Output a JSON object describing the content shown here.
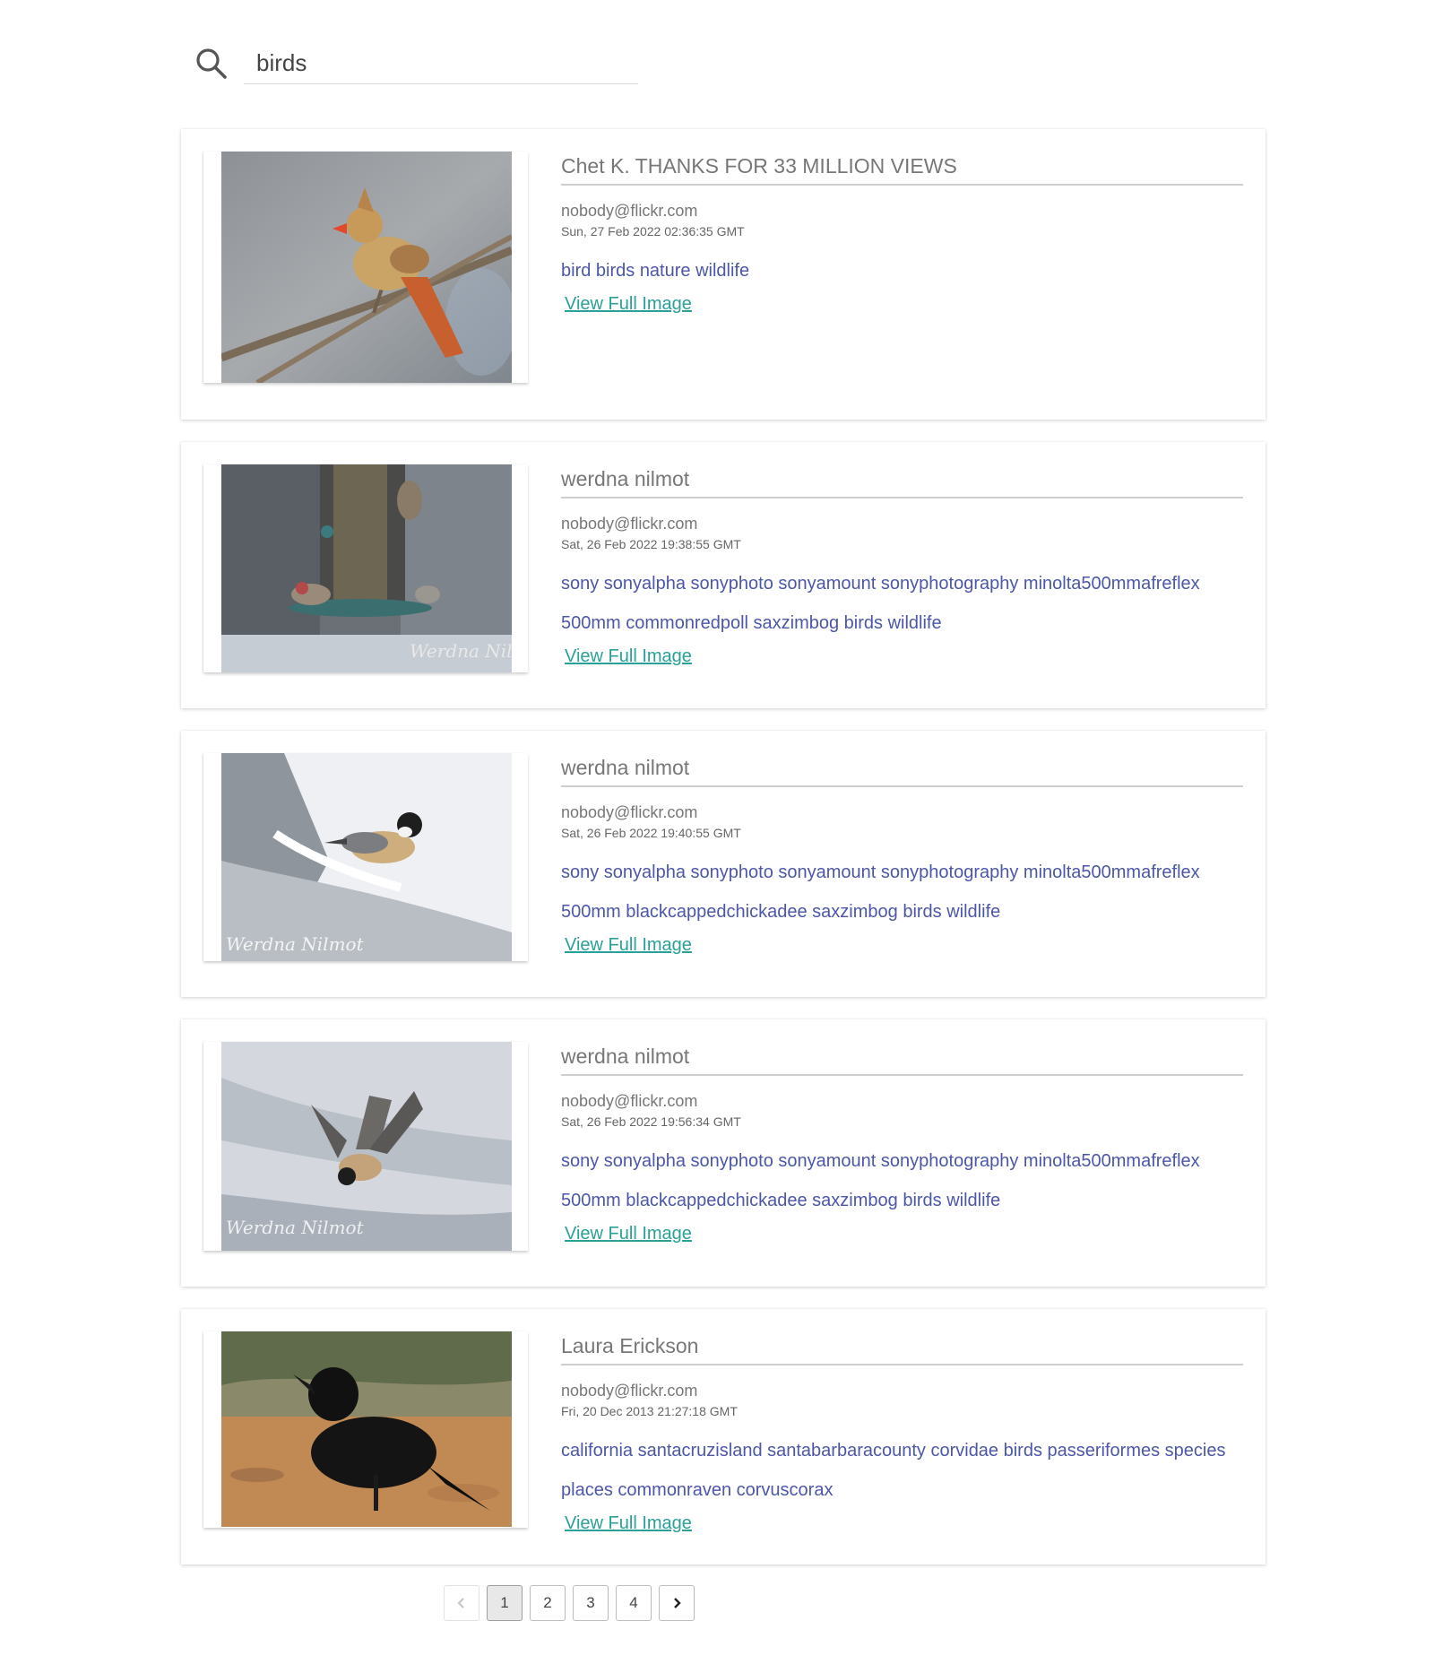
{
  "search": {
    "query": "birds",
    "icon": "search-icon"
  },
  "results": [
    {
      "title": "Chet K. THANKS FOR 33 MILLION VIEWS",
      "author": "nobody@flickr.com",
      "date": "Sun, 27 Feb 2022 02:36:35 GMT",
      "tags_line1": "bird birds nature wildlife",
      "tags_line2": "",
      "link": "View Full Image"
    },
    {
      "title": "werdna nilmot",
      "author": "nobody@flickr.com",
      "date": "Sat, 26 Feb 2022 19:38:55 GMT",
      "tags_line1": "sony sonyalpha sonyphoto sonyamount sonyphotography minolta500mmafreflex",
      "tags_line2": "500mm commonredpoll saxzimbog birds wildlife",
      "link": "View Full Image"
    },
    {
      "title": "werdna nilmot",
      "author": "nobody@flickr.com",
      "date": "Sat, 26 Feb 2022 19:40:55 GMT",
      "tags_line1": "sony sonyalpha sonyphoto sonyamount sonyphotography minolta500mmafreflex",
      "tags_line2": "500mm blackcappedchickadee saxzimbog birds wildlife",
      "link": "View Full Image"
    },
    {
      "title": "werdna nilmot",
      "author": "nobody@flickr.com",
      "date": "Sat, 26 Feb 2022 19:56:34 GMT",
      "tags_line1": "sony sonyalpha sonyphoto sonyamount sonyphotography minolta500mmafreflex",
      "tags_line2": "500mm blackcappedchickadee saxzimbog birds wildlife",
      "link": "View Full Image"
    },
    {
      "title": "Laura Erickson",
      "author": "nobody@flickr.com",
      "date": "Fri, 20 Dec 2013 21:27:18 GMT",
      "tags_line1": "california santacruzisland santabarbaracounty corvidae birds passeriformes species",
      "tags_line2": "places commonraven corvuscorax",
      "link": "View Full Image"
    }
  ],
  "pagination": {
    "prev_icon": "chevron-left-icon",
    "next_icon": "chevron-right-icon",
    "pages": [
      "1",
      "2",
      "3",
      "4"
    ],
    "current": "1"
  },
  "colors": {
    "tag": "#4b57a8",
    "link": "#2aa198",
    "title": "#777777"
  }
}
